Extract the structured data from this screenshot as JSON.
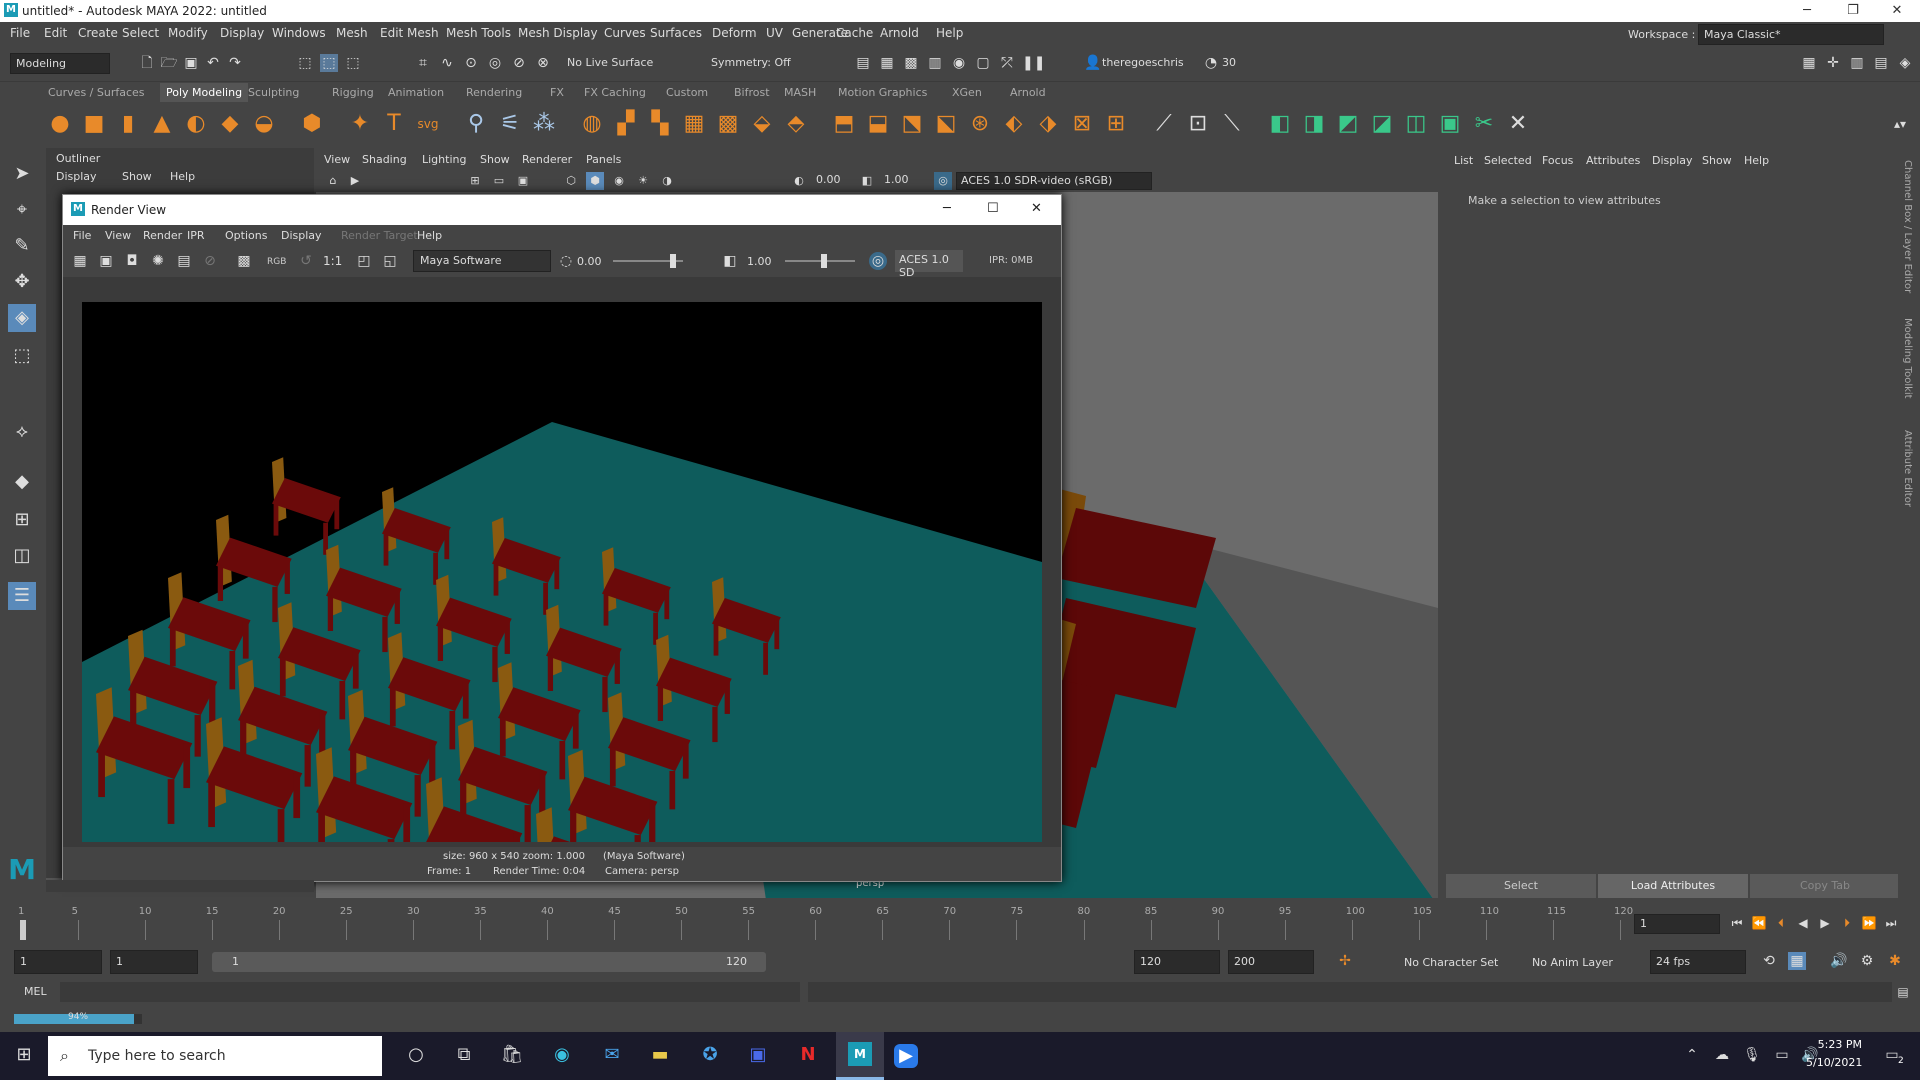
{
  "window": {
    "title": "untitled* - Autodesk MAYA 2022: untitled",
    "minimize": "─",
    "restore": "❐",
    "close": "✕"
  },
  "menubar": [
    "File",
    "Edit",
    "Create",
    "Select",
    "Modify",
    "Display",
    "Windows",
    "Mesh",
    "Edit Mesh",
    "Mesh Tools",
    "Mesh Display",
    "Curves",
    "Surfaces",
    "Deform",
    "UV",
    "Generate",
    "Cache",
    "Arnold",
    "Help"
  ],
  "status": {
    "mode": "Modeling",
    "live_surface": "No Live Surface",
    "symmetry": "Symmetry: Off",
    "user": "theregoeschris",
    "credits": "30",
    "workspace_label": "Workspace :",
    "workspace": "Maya Classic*"
  },
  "shelf_tabs": [
    "Curves / Surfaces",
    "Poly Modeling",
    "Sculpting",
    "Rigging",
    "Animation",
    "Rendering",
    "FX",
    "FX Caching",
    "Custom",
    "Bifrost",
    "MASH",
    "Motion Graphics",
    "XGen",
    "Arnold"
  ],
  "shelf_active": "Poly Modeling",
  "outliner": {
    "title": "Outliner",
    "menu": [
      "Display",
      "Show",
      "Help"
    ]
  },
  "viewport": {
    "menu": [
      "View",
      "Shading",
      "Lighting",
      "Show",
      "Renderer",
      "Panels"
    ],
    "exposure": "0.00",
    "gamma": "1.00",
    "colorspace": "ACES 1.0 SDR-video (sRGB)",
    "camera_label": "persp"
  },
  "attribute_editor": {
    "menu": [
      "List",
      "Selected",
      "Focus",
      "Attributes",
      "Display",
      "Show",
      "Help"
    ],
    "message": "Make a selection to view attributes",
    "buttons": [
      "Select",
      "Load Attributes",
      "Copy Tab"
    ]
  },
  "side_tabs": [
    "Channel Box / Layer Editor",
    "Modeling Toolkit",
    "Attribute Editor"
  ],
  "render_view": {
    "title": "Render View",
    "menu": [
      "File",
      "View",
      "Render",
      "IPR",
      "Options",
      "Display",
      "Render Target",
      "Help"
    ],
    "rgb_label": "RGB",
    "ratio": "1:1",
    "renderer": "Maya Software",
    "exposure": "0.00",
    "gamma": "1.00",
    "colorspace": "ACES 1.0 SD",
    "ipr": "IPR: 0MB",
    "info_line1": "size: 960 x 540 zoom: 1.000",
    "info_renderer": "(Maya Software)",
    "info_frame": "Frame: 1",
    "info_time": "Render Time: 0:04",
    "info_camera": "Camera: persp"
  },
  "timeline": {
    "ticks": [
      "1",
      "5",
      "10",
      "15",
      "20",
      "25",
      "30",
      "35",
      "40",
      "45",
      "50",
      "55",
      "60",
      "65",
      "70",
      "75",
      "80",
      "85",
      "90",
      "95",
      "100",
      "105",
      "110",
      "115",
      "120"
    ],
    "current_frame": "1"
  },
  "range": {
    "start": "1",
    "anim_start": "1",
    "slider_start": "1",
    "slider_end": "120",
    "end": "120",
    "anim_end": "200",
    "character_set": "No Character Set",
    "anim_layer": "No Anim Layer",
    "fps": "24 fps"
  },
  "cmdline": {
    "label": "MEL"
  },
  "progress": {
    "text": "94%",
    "value": 0.94
  },
  "taskbar": {
    "search_placeholder": "Type here to search",
    "time": "5:23 PM",
    "date": "5/10/2021",
    "notifications": "2"
  },
  "colors": {
    "teal_floor": "#0e5c5c",
    "chair_seat": "#6b0a0a",
    "chair_back": "#8a5a10",
    "accent": "#4aa3c9"
  }
}
